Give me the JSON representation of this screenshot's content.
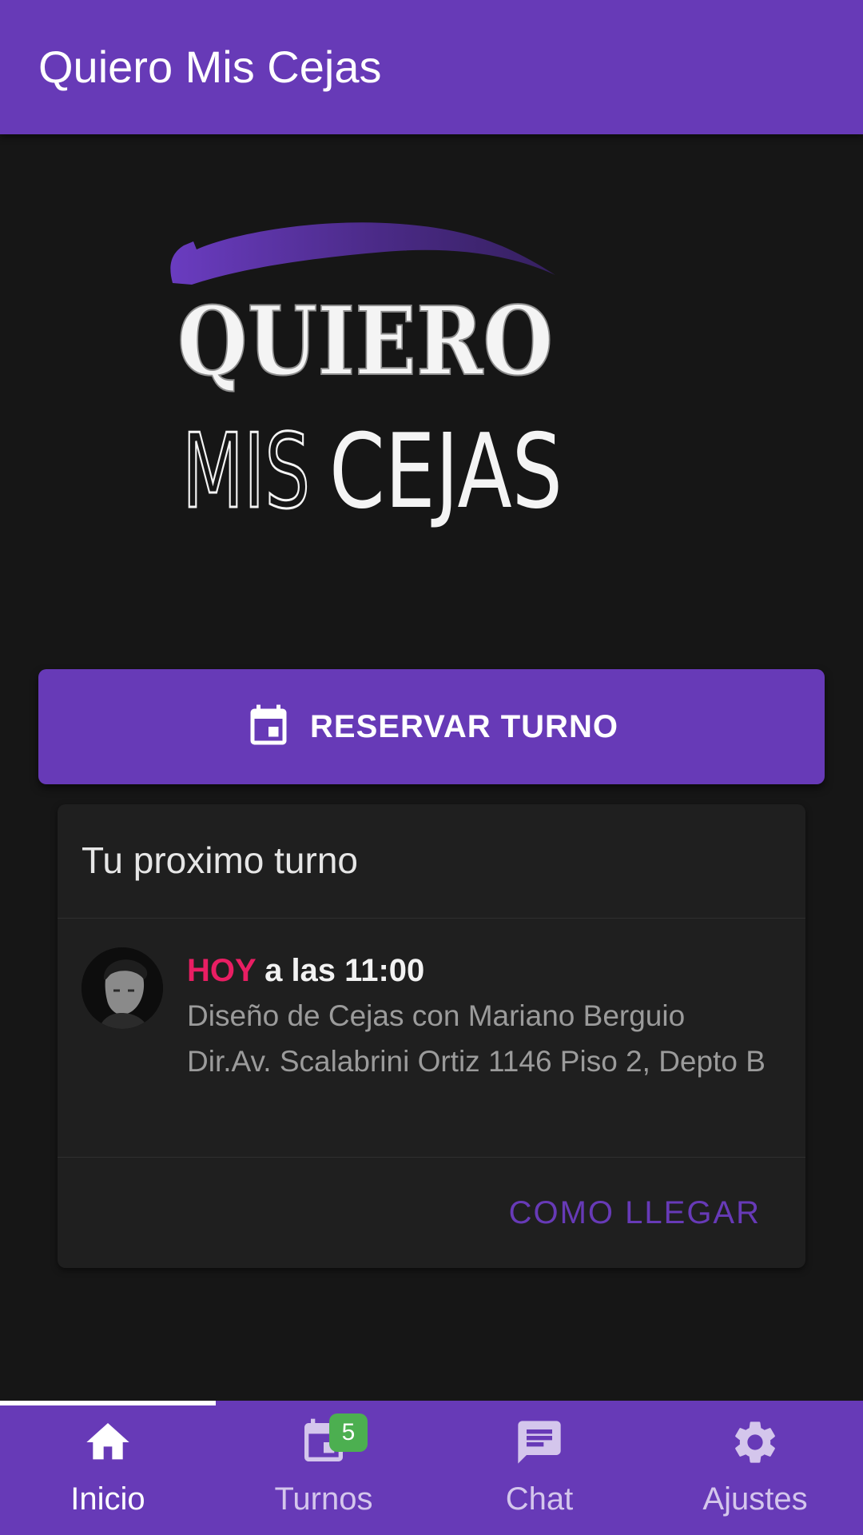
{
  "app_bar": {
    "title": "Quiero Mis Cejas"
  },
  "logo": {
    "line1": "QUIERO",
    "line2_light": "MIS",
    "line2_bold": "CEJAS",
    "accent_color": "#5b2fa0"
  },
  "reserve_button": {
    "icon": "calendar-icon",
    "label": "RESERVAR TURNO"
  },
  "next_appointment": {
    "title": "Tu proximo turno",
    "avatar": "avatar-photo",
    "today_label": "HOY",
    "time_text": " a las 11:00",
    "service_line": "Diseño de Cejas con Mariano Berguio",
    "address_line": "Dir.Av. Scalabrini Ortiz 1146 Piso 2, Depto B",
    "directions_label": "COMO LLEGAR"
  },
  "bottom_nav": {
    "active_tab": "Inicio",
    "tabs": [
      {
        "label": "Inicio",
        "icon": "home-icon"
      },
      {
        "label": "Turnos",
        "icon": "calendar-icon",
        "badge": "5"
      },
      {
        "label": "Chat",
        "icon": "chat-icon"
      },
      {
        "label": "Ajustes",
        "icon": "gear-icon"
      }
    ]
  },
  "colors": {
    "primary": "#673ab7",
    "background": "#161616",
    "card": "#1f1f1f",
    "today_accent": "#e91e63",
    "badge": "#4caf50"
  }
}
